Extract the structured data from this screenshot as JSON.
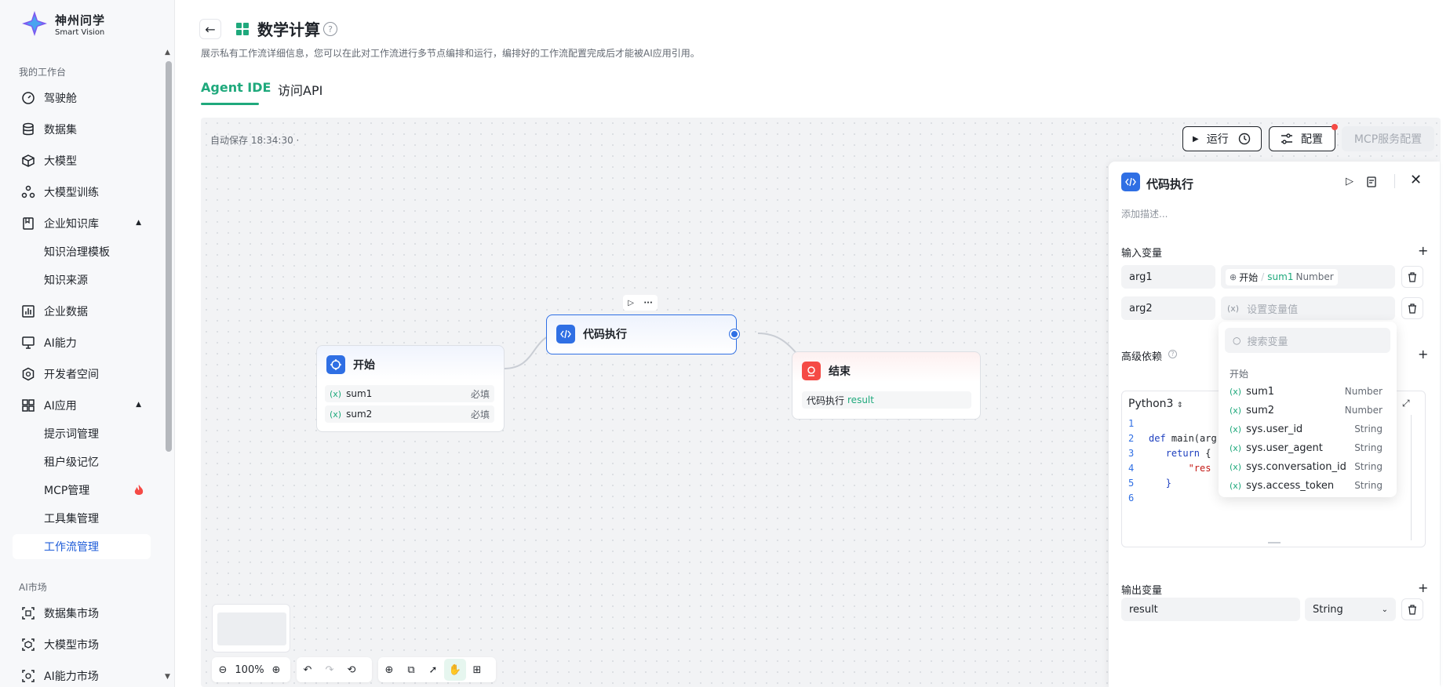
{
  "brand": {
    "name": "神州问学",
    "sub": "Smart Vision"
  },
  "sidebar": {
    "section_workspace": "我的工作台",
    "items": [
      {
        "label": "驾驶舱",
        "icon": "dashboard-icon"
      },
      {
        "label": "数据集",
        "icon": "database-icon"
      },
      {
        "label": "大模型",
        "icon": "cube-icon"
      },
      {
        "label": "大模型训练",
        "icon": "training-icon"
      },
      {
        "label": "企业知识库",
        "icon": "book-icon"
      },
      {
        "label": "企业数据",
        "icon": "chart-icon"
      },
      {
        "label": "AI能力",
        "icon": "monitor-icon"
      },
      {
        "label": "开发者空间",
        "icon": "hex-icon"
      },
      {
        "label": "AI应用",
        "icon": "grid-icon"
      }
    ],
    "knowledge_sub": [
      "知识治理模板",
      "知识来源"
    ],
    "app_sub": [
      "提示词管理",
      "租户级记忆",
      "MCP管理",
      "工具集管理",
      "工作流管理"
    ],
    "section_market": "AI市场",
    "market_items": [
      {
        "label": "数据集市场",
        "icon": "dataset-market-icon"
      },
      {
        "label": "大模型市场",
        "icon": "model-market-icon"
      },
      {
        "label": "AI能力市场",
        "icon": "ai-market-icon"
      }
    ]
  },
  "header": {
    "back": "←",
    "title": "数学计算",
    "description": "展示私有工作流详细信息，您可以在此对工作流进行多节点编排和运行，编排好的工作流配置完成后才能被AI应用引用。",
    "tabs": [
      "Agent IDE",
      "访问API"
    ]
  },
  "canvas": {
    "autosave": "自动保存 18:34:30 ·",
    "run_label": "运行",
    "config_label": "配置",
    "mcp_label": "MCP服务配置",
    "zoom": "100%"
  },
  "nodes": {
    "start": {
      "title": "开始",
      "vars": [
        {
          "name": "sum1",
          "req": "必填"
        },
        {
          "name": "sum2",
          "req": "必填"
        }
      ]
    },
    "code": {
      "title": "代码执行"
    },
    "end": {
      "title": "结束",
      "ref_node": "代码执行",
      "ref_var": "result"
    }
  },
  "panel": {
    "title": "代码执行",
    "desc": "添加描述...",
    "input_label": "输入变量",
    "arg1": "arg1",
    "arg1_node": "开始",
    "arg1_sep": "/",
    "arg1_var": "sum1",
    "arg1_type": "Number",
    "arg2": "arg2",
    "arg2_placeholder": "设置变量值",
    "adv_label": "高级依赖",
    "lang": "Python3",
    "code": {
      "l1": "",
      "l2_kw": "def",
      "l2_rest": " main(arg",
      "l3_kw": "return",
      "l3_rest": " {",
      "l4_str": "\"res",
      "l5": "}",
      "l6": ""
    },
    "output_label": "输出变量",
    "out_name": "result",
    "out_type": "String"
  },
  "dropdown": {
    "search_placeholder": "搜索变量",
    "group": "开始",
    "items": [
      {
        "name": "sum1",
        "type": "Number"
      },
      {
        "name": "sum2",
        "type": "Number"
      },
      {
        "name": "sys.user_id",
        "type": "String"
      },
      {
        "name": "sys.user_agent",
        "type": "String"
      },
      {
        "name": "sys.conversation_id",
        "type": "String"
      },
      {
        "name": "sys.access_token",
        "type": "String"
      }
    ]
  },
  "colors": {
    "accent": "#1fa97c",
    "primary": "#2f6fe4",
    "danger": "#f54a45"
  }
}
